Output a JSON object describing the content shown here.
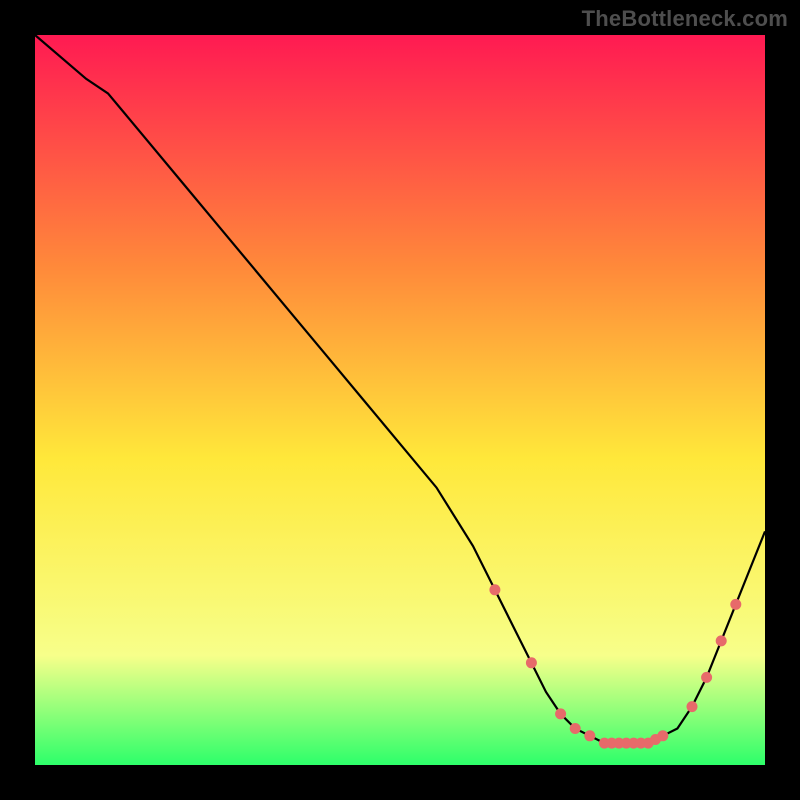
{
  "watermark": "TheBottleneck.com",
  "colors": {
    "gradient_top": "#ff1a52",
    "gradient_upper_mid": "#ff8a3a",
    "gradient_mid": "#ffe83a",
    "gradient_lower": "#f7ff8a",
    "gradient_bottom": "#2dff6a",
    "bg": "#000000",
    "line": "#000000",
    "marker": "#e76a6a"
  },
  "chart_data": {
    "type": "line",
    "title": "",
    "xlabel": "",
    "ylabel": "",
    "xlim": [
      0,
      100
    ],
    "ylim": [
      0,
      100
    ],
    "series": [
      {
        "name": "bottleneck-curve",
        "x": [
          0,
          7,
          10,
          15,
          20,
          25,
          30,
          35,
          40,
          45,
          50,
          55,
          60,
          63,
          66,
          68,
          70,
          72,
          74,
          76,
          78,
          80,
          82,
          84,
          86,
          88,
          90,
          92,
          94,
          96,
          98,
          100
        ],
        "y": [
          100,
          94,
          92,
          86,
          80,
          74,
          68,
          62,
          56,
          50,
          44,
          38,
          30,
          24,
          18,
          14,
          10,
          7,
          5,
          4,
          3,
          3,
          3,
          3,
          4,
          5,
          8,
          12,
          17,
          22,
          27,
          32
        ]
      }
    ],
    "markers": {
      "name": "highlight-points",
      "x": [
        63,
        68,
        72,
        74,
        76,
        78,
        79,
        80,
        81,
        82,
        83,
        84,
        85,
        86,
        90,
        92,
        94,
        96
      ],
      "y": [
        24,
        14,
        7,
        5,
        4,
        3,
        3,
        3,
        3,
        3,
        3,
        3,
        3.5,
        4,
        8,
        12,
        17,
        22
      ]
    }
  }
}
